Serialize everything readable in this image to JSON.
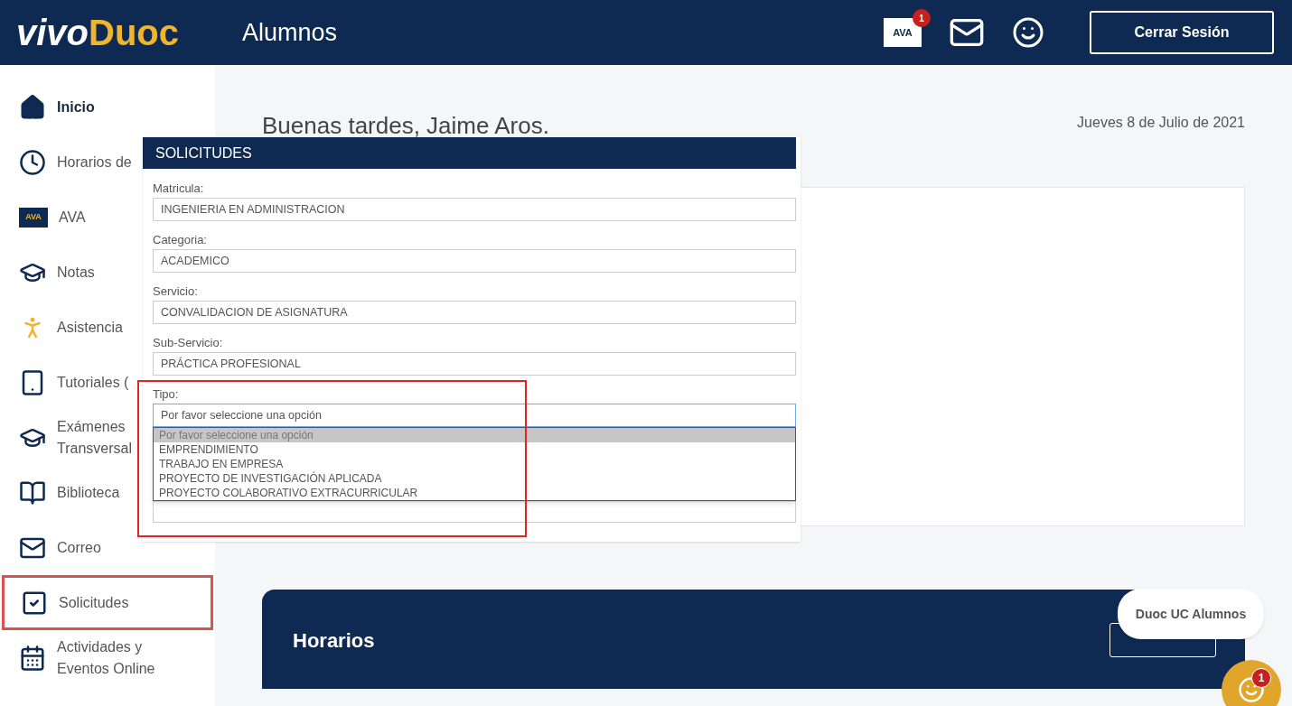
{
  "header": {
    "logo_primary": "vivo",
    "logo_secondary": "Duoc",
    "section": "Alumnos",
    "ava_label": "AVA",
    "ava_badge": "1",
    "logout": "Cerrar Sesión"
  },
  "sidebar": {
    "items": [
      {
        "kind": "home",
        "lines": [
          "Inicio"
        ],
        "selected": true,
        "highlighted": false
      },
      {
        "kind": "clock",
        "lines": [
          "Horarios de"
        ],
        "selected": false,
        "highlighted": false
      },
      {
        "kind": "ava",
        "icon_label": "AVA",
        "lines": [
          "AVA"
        ],
        "selected": false,
        "highlighted": false
      },
      {
        "kind": "cap",
        "lines": [
          "Notas"
        ],
        "selected": false,
        "highlighted": false
      },
      {
        "kind": "person",
        "lines": [
          "Asistencia"
        ],
        "selected": false,
        "highlighted": false
      },
      {
        "kind": "tablet",
        "lines": [
          "Tutoriales ("
        ],
        "selected": false,
        "highlighted": false
      },
      {
        "kind": "cap",
        "lines": [
          "Exámenes",
          "Transversal"
        ],
        "selected": false,
        "highlighted": false
      },
      {
        "kind": "book",
        "lines": [
          "Biblioteca"
        ],
        "selected": false,
        "highlighted": false
      },
      {
        "kind": "mail",
        "lines": [
          "Correo"
        ],
        "selected": false,
        "highlighted": false
      },
      {
        "kind": "check",
        "lines": [
          "Solicitudes"
        ],
        "selected": false,
        "highlighted": true
      },
      {
        "kind": "calendar",
        "lines": [
          "Actividades y",
          "Eventos Online"
        ],
        "selected": false,
        "highlighted": false
      }
    ]
  },
  "main": {
    "greeting": "Buenas tardes, Jaime Aros.",
    "date": "Jueves 8 de Julio de 2021",
    "horarios_title": "Horarios"
  },
  "dialog": {
    "title": "SOLICITUDES",
    "fields": [
      {
        "label": "Matricula:",
        "value": "INGENIERIA EN ADMINISTRACION",
        "focused": false
      },
      {
        "label": "Categoria:",
        "value": "ACADEMICO",
        "focused": false
      },
      {
        "label": "Servicio:",
        "value": "CONVALIDACION DE ASIGNATURA",
        "focused": false
      },
      {
        "label": "Sub-Servicio:",
        "value": "PRÁCTICA PROFESIONAL",
        "focused": false
      },
      {
        "label": "Tipo:",
        "value": "Por favor seleccione una opción",
        "focused": true
      }
    ],
    "options": [
      {
        "label": "Por favor seleccione una opción",
        "selected": true
      },
      {
        "label": "EMPRENDIMIENTO",
        "selected": false
      },
      {
        "label": "TRABAJO EN EMPRESA",
        "selected": false
      },
      {
        "label": "PROYECTO DE INVESTIGACIÓN APLICADA",
        "selected": false
      },
      {
        "label": "PROYECTO COLABORATIVO EXTRACURRICULAR",
        "selected": false
      }
    ]
  },
  "chat": {
    "bubble": "Duoc UC Alumnos",
    "badge": "1"
  }
}
